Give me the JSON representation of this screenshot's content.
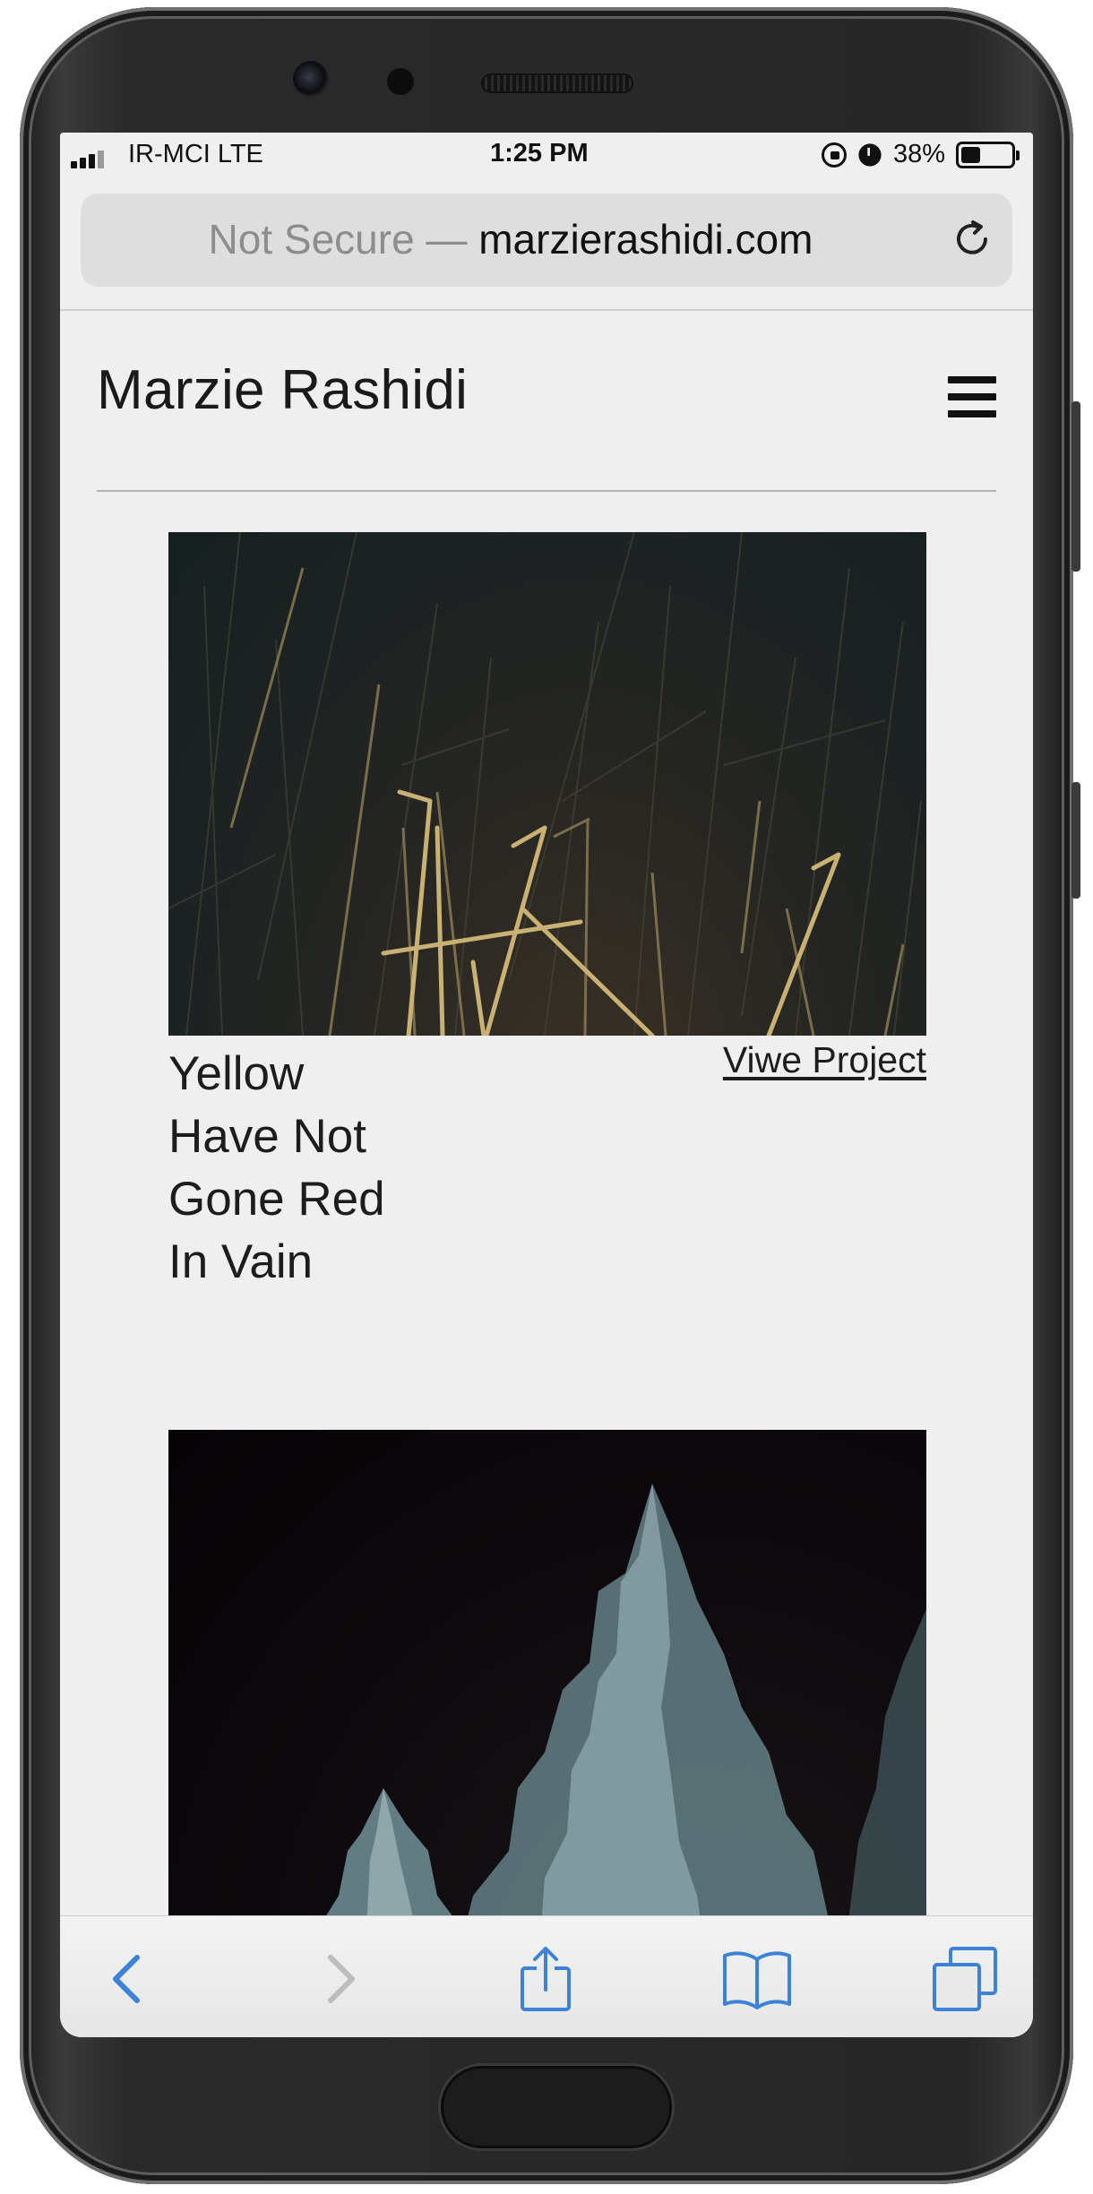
{
  "status_bar": {
    "carrier": "IR-MCI  LTE",
    "time": "1:25 PM",
    "battery": "38%",
    "battery_level": 0.38
  },
  "browser": {
    "url_prefix": "Not Secure —",
    "url_domain": "marzierashidi.com"
  },
  "site": {
    "title": "Marzie Rashidi"
  },
  "projects": [
    {
      "title_lines": [
        "Yellow",
        "Have Not",
        "Gone Red",
        "In Vain"
      ],
      "link": "Viwe Project"
    }
  ],
  "toolbar_icons": [
    "back-icon",
    "forward-icon",
    "share-icon",
    "bookmarks-icon",
    "tabs-icon"
  ],
  "colors": {
    "toolbar_accent": "#3b82d8",
    "toolbar_disabled": "#bdbdbd",
    "screen_background": "#efeff0"
  }
}
